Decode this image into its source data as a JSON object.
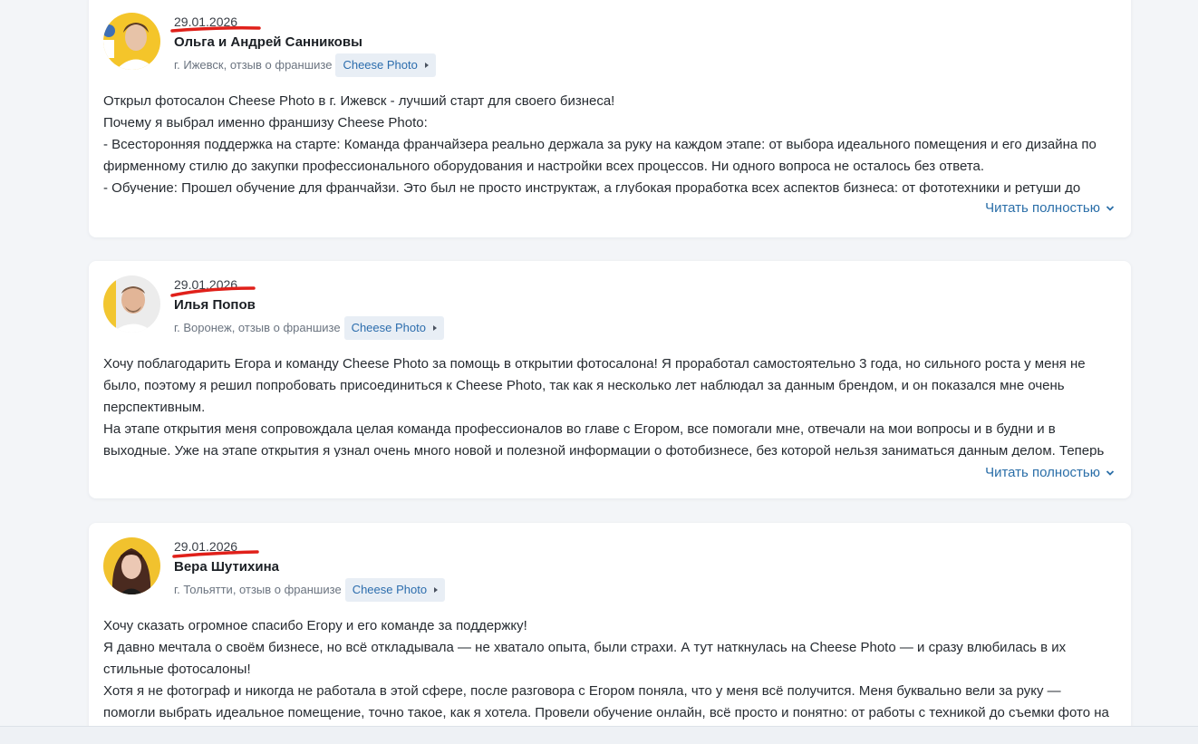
{
  "reviews": [
    {
      "date": "29.01.2026",
      "author": "Ольга и Андрей Санниковы",
      "location": "г. Ижевск, отзыв о франшизе",
      "franchise": "Cheese Photo",
      "lines": [
        "Открыл фотосалон Cheese Photo в г. Ижевск - лучший старт для своего бизнеса!",
        "Почему я выбрал именно франшизу Cheese Photo:",
        "- Всесторонняя поддержка на старте: Команда франчайзера реально держала за руку на каждом этапе: от выбора идеального помещения и его дизайна по фирменному стилю до закупки профессионального оборудования и настройки всех процессов. Ни одного вопроса не осталось без ответа.",
        "- Обучение: Прошел обучение для франчайзи. Это был не просто инструктаж, а глубокая проработка всех аспектов бизнеса: от фототехники и ретуши до"
      ],
      "read_more": "Читать полностью"
    },
    {
      "date": "29.01.2026",
      "author": "Илья Попов",
      "location": "г. Воронеж, отзыв о франшизе",
      "franchise": "Cheese Photo",
      "lines": [
        "Хочу поблагодарить Егора и команду Cheese Photo за помощь в открытии фотосалона! Я проработал самостоятельно 3 года, но сильного роста у меня не было, поэтому я решил попробовать присоединиться к Cheese Photo, так как я несколько лет наблюдал за данным брендом, и он показался мне очень перспективным.",
        "На этапе открытия меня сопровождала целая команда профессионалов во главе с Егором, все помогали мне, отвечали на мои вопросы и в будни и в выходные. Уже на этапе открытия я узнал очень много новой и полезной информации о фотобизнесе, без которой нельзя заниматься данным делом. Теперь"
      ],
      "read_more": "Читать полностью"
    },
    {
      "date": "29.01.2026",
      "author": "Вера Шутихина",
      "location": "г. Тольятти, отзыв о франшизе",
      "franchise": "Cheese Photo",
      "lines": [
        "Хочу сказать огромное спасибо Егору и его команде за поддержку!",
        "Я давно мечтала о своём бизнесе, но всё откладывала — не хватало опыта, были страхи. А тут наткнулась на Cheese Photo — и сразу влюбилась в их стильные фотосалоны!",
        "Хотя я не фотограф и никогда не работала в этой сфере, после разговора с Егором поняла, что у меня всё получится. Меня буквально вели за руку — помогли выбрать идеальное помещение, точно такое, как я хотела. Провели обучение онлайн, всё просто и понятно: от работы с техникой до съемки фото на"
      ]
    }
  ],
  "colors": {
    "accent_link": "#2a6ea8",
    "chip_bg": "#e8eef5",
    "annotation_red": "#e0201a"
  },
  "icons": {
    "chip_arrow": "caret-right-icon",
    "read_more_arrow": "chevron-down-icon"
  }
}
